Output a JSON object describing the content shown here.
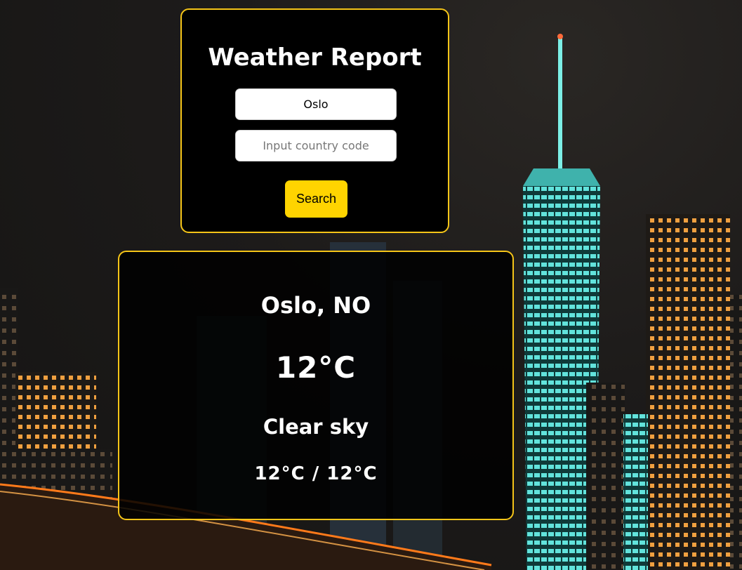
{
  "search": {
    "title": "Weather Report",
    "city_value": "Oslo",
    "country_placeholder": "Input country code",
    "country_value": "",
    "button_label": "Search"
  },
  "result": {
    "location": "Oslo, NO",
    "temperature": "12°C",
    "description": "Clear sky",
    "range": "12°C / 12°C"
  },
  "colors": {
    "accent_border": "#f5c518",
    "button": "#ffd400",
    "card_background": "#000000",
    "text": "#ffffff"
  }
}
